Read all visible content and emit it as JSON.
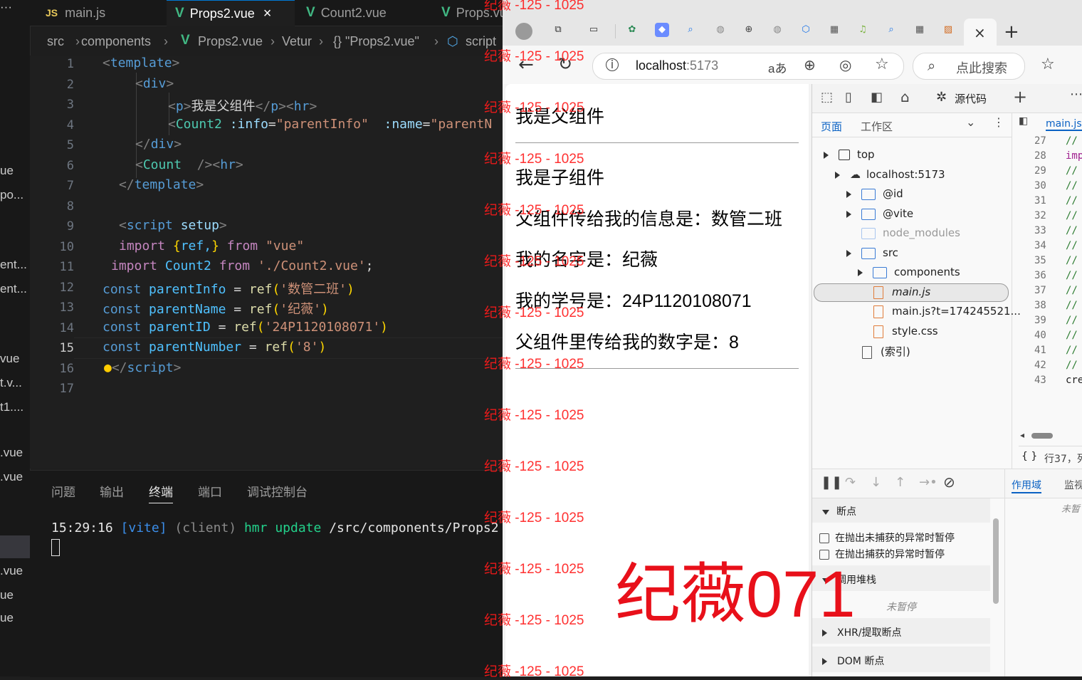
{
  "vscode": {
    "explorer_fragments": [
      "ue",
      "po...",
      "ent...",
      "ent...",
      "vue",
      "t.v...",
      "t1....",
      ".vue",
      ".vue",
      ".vue",
      "ue",
      "ue"
    ],
    "tabs": [
      {
        "icon": "js",
        "label": "main.js",
        "active": false
      },
      {
        "icon": "vue",
        "label": "Props2.vue",
        "active": true,
        "close": "×"
      },
      {
        "icon": "vue",
        "label": "Count2.vue",
        "active": false
      },
      {
        "icon": "vue",
        "label": "Props.vue",
        "active": false
      }
    ],
    "breadcrumb": [
      "src",
      "components",
      "Props2.vue",
      "Vetur",
      "{} \"Props2.vue\"",
      "script"
    ],
    "line_numbers": [
      "1",
      "2",
      "3",
      "4",
      "5",
      "6",
      "7",
      "8",
      "9",
      "10",
      "11",
      "12",
      "13",
      "14",
      "15",
      "16",
      "17"
    ],
    "current_line": "15",
    "code": {
      "l1_tag": "template",
      "l2_tag": "div",
      "l3_text": "我是父组件",
      "l3_tag_p": "p",
      "l3_tag_hr": "hr",
      "l4_comp": "Count2",
      "l4_attr1": ":info",
      "l4_val1": "\"parentInfo\"",
      "l4_attr2": ":name",
      "l4_val2": "\"parentN",
      "l5_tag": "div",
      "l6_comp": "Count",
      "l6_tag_hr": "hr",
      "l7_tag": "template",
      "l9_tag": "script",
      "l9_attr": "setup",
      "l10_kw": "import",
      "l10_names": "ref,",
      "l10_from": "from",
      "l10_src": "\"vue\"",
      "l11_kw": "import",
      "l11_name": "Count2",
      "l11_from": "from",
      "l11_src": "'./Count2.vue'",
      "l12_var": "parentInfo",
      "l12_str": "'数管二班'",
      "l13_var": "parentName",
      "l13_str": "'纪薇'",
      "l14_var": "parentID",
      "l14_str": "'24P1120108071'",
      "l15_var": "parentNumber",
      "l15_str": "'8'",
      "const_kw": "const",
      "ref_fn": "ref",
      "l16_tag": "script"
    },
    "panel_tabs": [
      "问题",
      "输出",
      "终端",
      "端口",
      "调试控制台"
    ],
    "panel_active": "终端",
    "terminal": {
      "time": "15:29:16",
      "tag": "[vite]",
      "client": "(client)",
      "hmr": "hmr update",
      "path": "/src/components/Props2"
    }
  },
  "browser": {
    "url_host": "localhost",
    "url_port": ":5173",
    "search_placeholder": "点此搜索",
    "page": {
      "parent_title": "我是父组件",
      "child_title": "我是子组件",
      "info_line": "父组件传给我的信息是：数管二班",
      "name_line": "我的名字是：纪薇",
      "id_line": "我的学号是：24P1120108071",
      "number_line": "父组件里传给我的数字是：8"
    },
    "devtools": {
      "sources_tab": "源代码",
      "subtabs": [
        "页面",
        "工作区"
      ],
      "file_tab": "main.js",
      "tree": [
        {
          "label": "top",
          "type": "frame"
        },
        {
          "label": "localhost:5173",
          "type": "cloud"
        },
        {
          "label": "@id",
          "type": "folder"
        },
        {
          "label": "@vite",
          "type": "folder"
        },
        {
          "label": "node_modules",
          "type": "folder-muted"
        },
        {
          "label": "src",
          "type": "folder"
        },
        {
          "label": "components",
          "type": "folder"
        },
        {
          "label": "main.js",
          "type": "file",
          "selected": true
        },
        {
          "label": "main.js?t=174245521...",
          "type": "file"
        },
        {
          "label": "style.css",
          "type": "file"
        },
        {
          "label": "(索引)",
          "type": "page"
        }
      ],
      "code_lines": [
        "27",
        "28",
        "29",
        "30",
        "31",
        "32",
        "33",
        "34",
        "35",
        "36",
        "37",
        "38",
        "39",
        "40",
        "41",
        "42",
        "43"
      ],
      "code_snips": [
        "//",
        "imp",
        "//",
        "//",
        "//",
        "//",
        "//",
        "//",
        "//",
        "//",
        "//",
        "//",
        "//",
        "//",
        "//",
        "//",
        "cre"
      ],
      "status": "行37，列",
      "scope_tabs": [
        "作用域",
        "监视"
      ],
      "not_paused_right": "未暂",
      "breakpoints_header": "断点",
      "bp_uncaught": "在抛出未捕获的异常时暂停",
      "bp_caught": "在抛出捕获的异常时暂停",
      "callstack_header": "调用堆栈",
      "not_paused": "未暂停",
      "xhr_bp": "XHR/提取断点",
      "dom_bp": "DOM 断点"
    }
  },
  "watermark": {
    "repeat_text": "纪薇 -125 - 1025",
    "big_text": "纪薇071",
    "color": "#ff1a1a"
  }
}
